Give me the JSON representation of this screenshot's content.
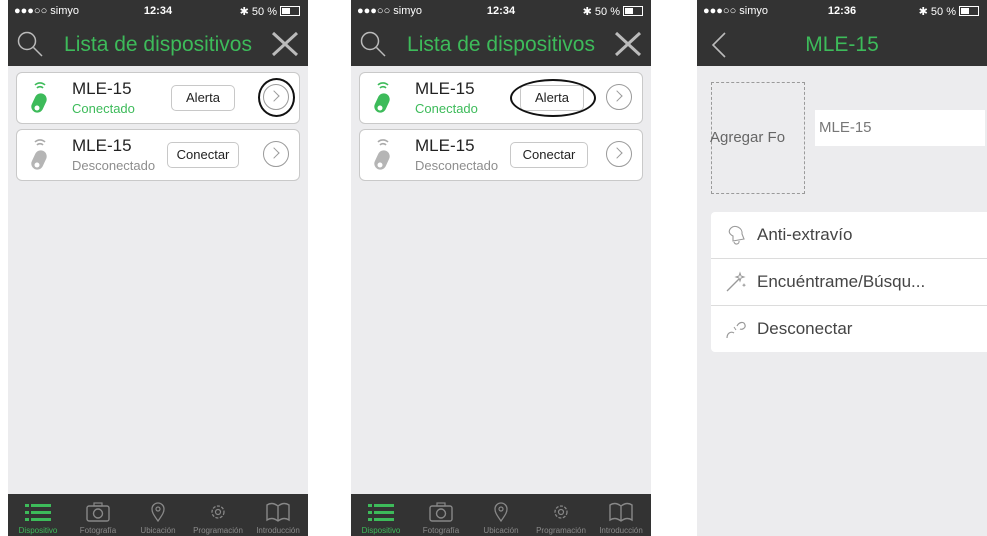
{
  "colors": {
    "accent": "#3dbb5a",
    "bar": "#333333",
    "background": "#ececee"
  },
  "screen_list_1": {
    "status": {
      "carrier": "●●●○○ simyo",
      "time": "12:34",
      "battery": "50 %"
    },
    "title": "Lista de dispositivos",
    "devices": [
      {
        "name": "MLE-15",
        "status": "Conectado",
        "action": "Alerta"
      },
      {
        "name": "MLE-15",
        "status": "Desconectado",
        "action": "Conectar"
      }
    ]
  },
  "screen_list_2": {
    "status": {
      "carrier": "●●●○○ simyo",
      "time": "12:34",
      "battery": "50 %"
    },
    "title": "Lista de dispositivos",
    "devices": [
      {
        "name": "MLE-15",
        "status": "Conectado",
        "action": "Alerta"
      },
      {
        "name": "MLE-15",
        "status": "Desconectado",
        "action": "Conectar"
      }
    ]
  },
  "tabs": [
    {
      "label": "Dispositivo",
      "icon": "list-icon"
    },
    {
      "label": "Fotografía",
      "icon": "camera-icon"
    },
    {
      "label": "Ubicación",
      "icon": "location-pin-icon"
    },
    {
      "label": "Programación",
      "icon": "gear-icon"
    },
    {
      "label": "Introducción",
      "icon": "book-icon"
    }
  ],
  "screen_detail": {
    "status": {
      "carrier": "●●●○○ simyo",
      "time": "12:36",
      "battery": "50 %"
    },
    "title": "MLE-15",
    "photo_label": "Agregar Fo",
    "name_value": "MLE-15",
    "menu": [
      {
        "label": "Anti-extravío",
        "icon": "alarm-icon"
      },
      {
        "label": "Encuéntrame/Búsqu...",
        "icon": "magic-wand-icon"
      },
      {
        "label": "Desconectar",
        "icon": "unlink-icon"
      }
    ]
  }
}
